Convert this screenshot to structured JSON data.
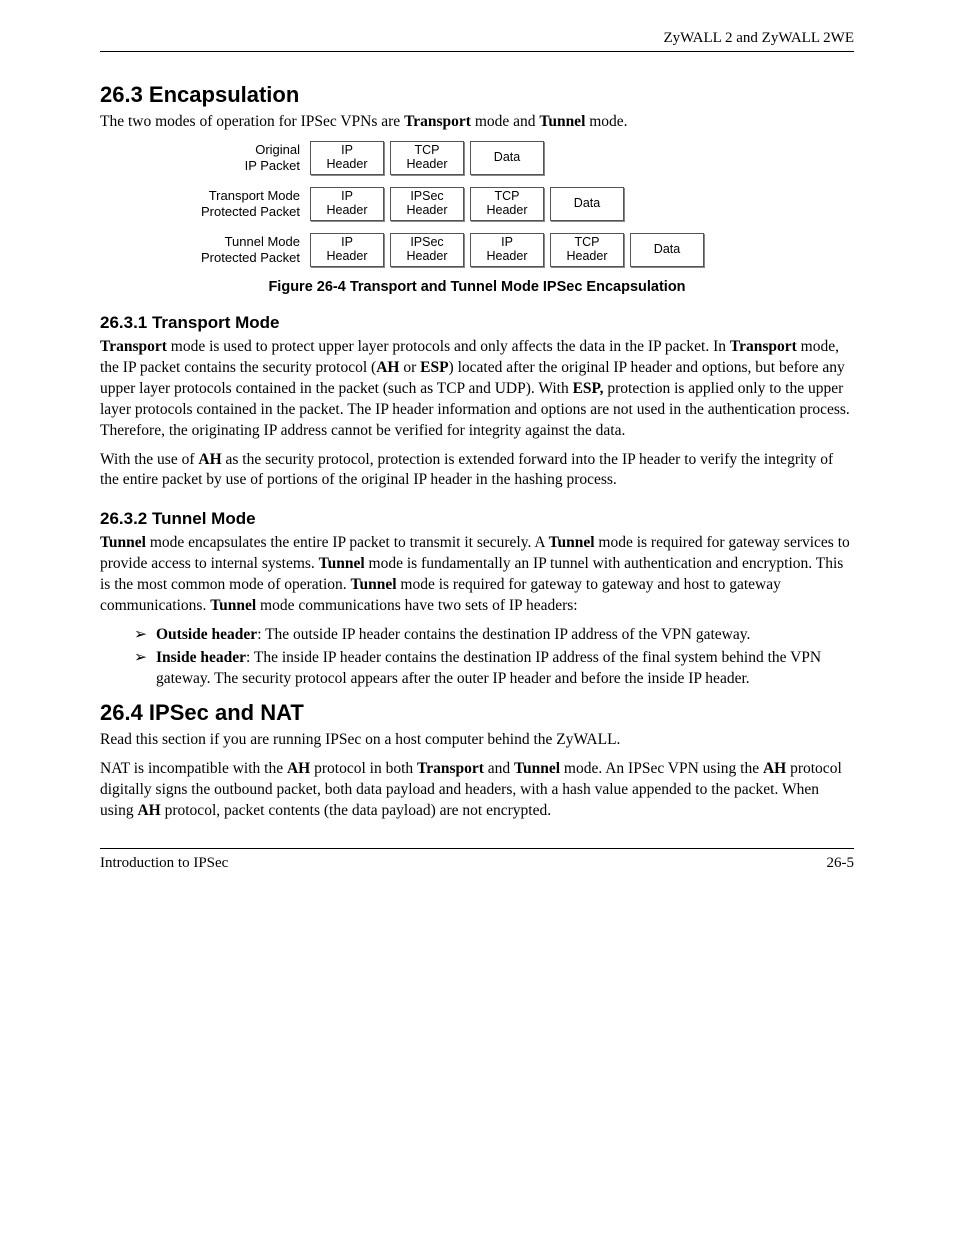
{
  "header": {
    "doc_title": "ZyWALL 2 and ZyWALL 2WE"
  },
  "s263": {
    "heading": "26.3  Encapsulation",
    "intro_a": "The two modes of operation for IPSec VPNs are ",
    "intro_b": "Transport",
    "intro_c": " mode and ",
    "intro_d": "Tunnel",
    "intro_e": " mode."
  },
  "diagram": {
    "rows": [
      {
        "label_l1": "Original",
        "label_l2": "IP Packet",
        "boxes": [
          "IP\nHeader",
          "TCP\nHeader",
          "Data"
        ]
      },
      {
        "label_l1": "Transport Mode",
        "label_l2": "Protected Packet",
        "boxes": [
          "IP\nHeader",
          "IPSec\nHeader",
          "TCP\nHeader",
          "Data"
        ]
      },
      {
        "label_l1": "Tunnel Mode",
        "label_l2": "Protected Packet",
        "boxes": [
          "IP\nHeader",
          "IPSec\nHeader",
          "IP\nHeader",
          "TCP\nHeader",
          "Data"
        ]
      }
    ],
    "caption": "Figure 26-4 Transport and Tunnel Mode IPSec Encapsulation"
  },
  "s2631": {
    "heading": "26.3.1 Transport Mode",
    "p1": [
      {
        "t": "Transport",
        "b": true
      },
      {
        "t": " mode is used to protect upper layer protocols and only affects the data in the IP packet. In "
      },
      {
        "t": "Transport",
        "b": true
      },
      {
        "t": " mode, the IP packet contains the security protocol ("
      },
      {
        "t": "AH",
        "b": true
      },
      {
        "t": " or "
      },
      {
        "t": "ESP",
        "b": true
      },
      {
        "t": ") located after the original IP header and options, but before any upper layer protocols contained in the packet (such as TCP and UDP). With "
      },
      {
        "t": "ESP,",
        "b": true
      },
      {
        "t": " protection is applied only to the upper layer protocols contained in the packet. The IP header information and options are not used in the authentication process. Therefore, the originating IP address cannot be verified for integrity against the data."
      }
    ],
    "p2": [
      {
        "t": "With the use of "
      },
      {
        "t": "AH",
        "b": true
      },
      {
        "t": " as the security protocol, protection is extended forward into the IP header to verify the integrity of the entire packet by use of portions of the original IP header in the hashing process."
      }
    ]
  },
  "s2632": {
    "heading": "26.3.2 Tunnel Mode",
    "p1": [
      {
        "t": "Tunnel",
        "b": true
      },
      {
        "t": " mode encapsulates the entire IP packet to transmit it securely. A "
      },
      {
        "t": "Tunnel",
        "b": true
      },
      {
        "t": " mode is required for gateway services to provide access to internal systems. "
      },
      {
        "t": "Tunnel",
        "b": true
      },
      {
        "t": " mode is fundamentally an IP tunnel with authentication and encryption. This is the most common mode of operation. "
      },
      {
        "t": "Tunnel",
        "b": true
      },
      {
        "t": " mode is required for gateway to gateway and host to gateway communications. "
      },
      {
        "t": "Tunnel",
        "b": true
      },
      {
        "t": " mode communications have two sets of IP headers:"
      }
    ],
    "bullets": [
      [
        {
          "t": "Outside header",
          "b": true
        },
        {
          "t": ": The outside IP header contains the destination IP address of the VPN gateway."
        }
      ],
      [
        {
          "t": "Inside header",
          "b": true
        },
        {
          "t": ": The inside IP header contains the destination IP address of the final system behind the VPN gateway. The security protocol appears after the outer IP header and before the inside IP header."
        }
      ]
    ]
  },
  "s264": {
    "heading": "26.4  IPSec and NAT",
    "p1": [
      {
        "t": "Read this section if you are running IPSec on a host computer behind the ZyWALL."
      }
    ],
    "p2": [
      {
        "t": "NAT is incompatible with the "
      },
      {
        "t": "AH",
        "b": true
      },
      {
        "t": " protocol in both "
      },
      {
        "t": "Transport",
        "b": true
      },
      {
        "t": " and "
      },
      {
        "t": "Tunnel",
        "b": true
      },
      {
        "t": " mode. An IPSec VPN using the "
      },
      {
        "t": "AH",
        "b": true
      },
      {
        "t": " protocol digitally signs the outbound packet, both data payload and headers, with a hash value appended to the packet. When using "
      },
      {
        "t": "AH",
        "b": true
      },
      {
        "t": " protocol, packet contents (the data payload) are not encrypted."
      }
    ]
  },
  "footer": {
    "left": "Introduction to IPSec",
    "right": "26-5"
  }
}
